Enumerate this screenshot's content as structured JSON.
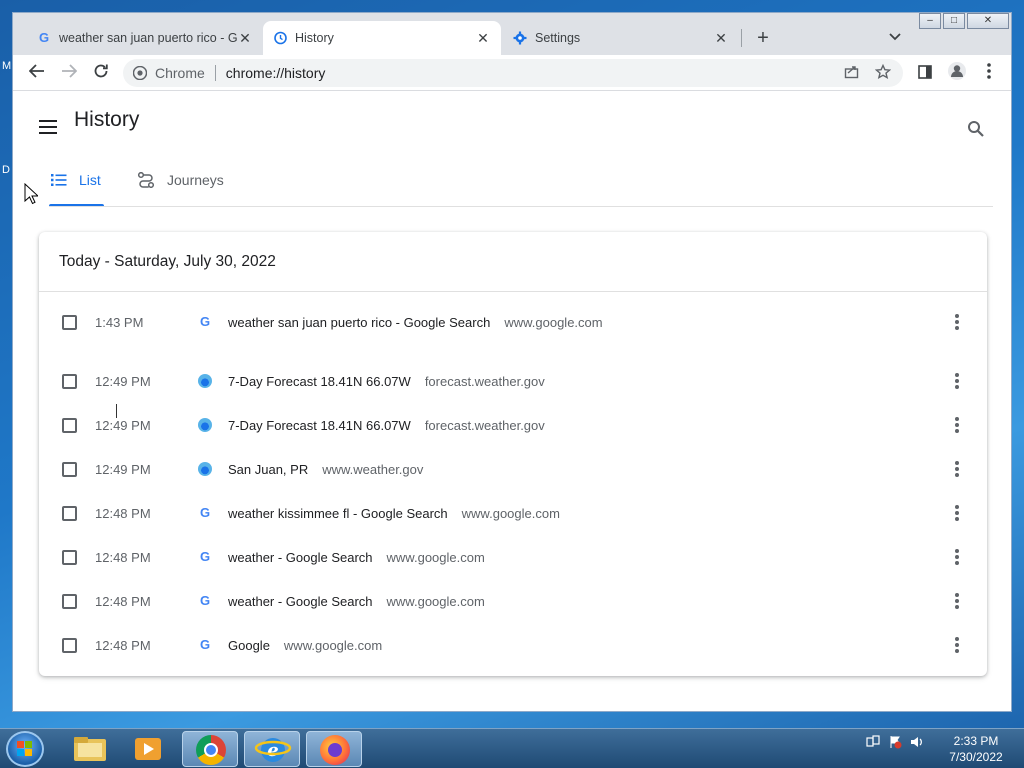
{
  "desktop": {
    "letters": [
      "M",
      "D"
    ]
  },
  "browser": {
    "tabs": [
      {
        "title": "weather san juan puerto rico - Google Search",
        "active": false
      },
      {
        "title": "History",
        "active": true
      },
      {
        "title": "Settings",
        "active": false
      }
    ],
    "new_tab": "+",
    "toolbar": {
      "omnibox_label": "Chrome",
      "omnibox_url": "chrome://history"
    }
  },
  "history": {
    "title": "History",
    "tabs": [
      {
        "label": "List",
        "active": true
      },
      {
        "label": "Journeys",
        "active": false
      }
    ],
    "date_header": "Today - Saturday, July 30, 2022",
    "items": [
      {
        "time": "1:43 PM",
        "favicon": "google-icon",
        "title": "weather san juan puerto rico - Google Search",
        "domain": "www.google.com"
      },
      {
        "time": "12:49 PM",
        "favicon": "noaa-icon",
        "title": "7-Day Forecast 18.41N 66.07W",
        "domain": "forecast.weather.gov"
      },
      {
        "time": "12:49 PM",
        "favicon": "noaa-icon",
        "title": "7-Day Forecast 18.41N 66.07W",
        "domain": "forecast.weather.gov"
      },
      {
        "time": "12:49 PM",
        "favicon": "noaa-icon",
        "title": "San Juan, PR",
        "domain": "www.weather.gov"
      },
      {
        "time": "12:48 PM",
        "favicon": "google-icon",
        "title": "weather kissimmee fl - Google Search",
        "domain": "www.google.com"
      },
      {
        "time": "12:48 PM",
        "favicon": "google-icon",
        "title": "weather - Google Search",
        "domain": "www.google.com"
      },
      {
        "time": "12:48 PM",
        "favicon": "google-icon",
        "title": "weather - Google Search",
        "domain": "www.google.com"
      },
      {
        "time": "12:48 PM",
        "favicon": "google-icon",
        "title": "Google",
        "domain": "www.google.com"
      }
    ]
  },
  "taskbar": {
    "apps": [
      "file-explorer-icon",
      "media-player-icon",
      "chrome-icon",
      "internet-explorer-icon",
      "firefox-icon"
    ],
    "clock_time": "2:33 PM",
    "clock_date": "7/30/2022"
  },
  "colors": {
    "accent": "#1a73e8",
    "tabstrip": "#dee1e6"
  }
}
